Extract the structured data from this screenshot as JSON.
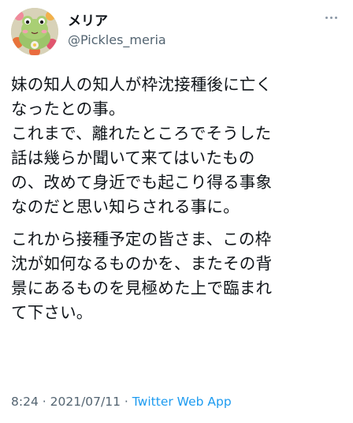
{
  "tweet": {
    "display_name": "メリア",
    "handle": "@Pickles_meria",
    "paragraphs": [
      [
        "妹の知人の知人が枠沈接種後に亡く",
        "なったとの事。",
        "これまで、離れたところでそうした",
        "話は幾らか聞いて来てはいたもの",
        "の、改めて身近でも起こり得る事象",
        "なのだと思い知らされる事に。"
      ],
      [
        "これから接種予定の皆さま、この枠",
        "沈が如何なるものかを、またその背",
        "景にあるものを見極めた上で臨まれ",
        "て下さい。"
      ]
    ],
    "time": "8:24",
    "separator": "·",
    "date": "2021/07/11",
    "source": "Twitter Web App"
  },
  "icons": {
    "avatar": "frog-plush-avatar",
    "more": "more-options-icon"
  },
  "colors": {
    "text": "#0f1419",
    "secondary": "#536471",
    "link": "#1d9bf0"
  }
}
